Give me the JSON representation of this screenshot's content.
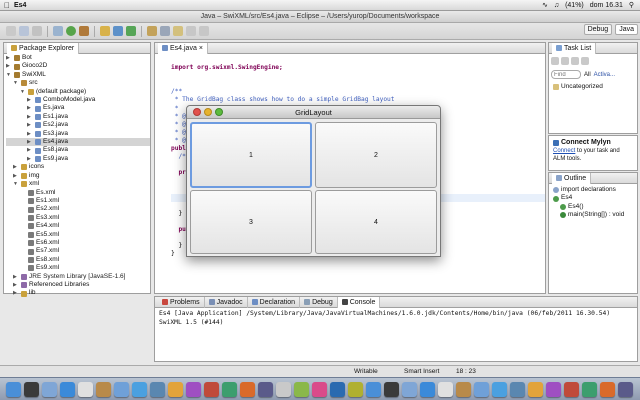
{
  "menubar": {
    "apple": "",
    "app_name": "Es4",
    "battery": "(41%)",
    "clock": "dom 16.31"
  },
  "window": {
    "title": "Java – SwiXML/src/Es4.java – Eclipse – /Users/yurop/Documents/workspace"
  },
  "perspectives": {
    "debug": "Debug",
    "java": "Java"
  },
  "package_explorer": {
    "tab": "Package Explorer",
    "rows": [
      {
        "label": "Bot",
        "indent": 0,
        "tri": "▶",
        "color": "#a47b2f"
      },
      {
        "label": "Gioco2D",
        "indent": 0,
        "tri": "▶",
        "color": "#a47b2f"
      },
      {
        "label": "SwiXML",
        "indent": 0,
        "tri": "▼",
        "color": "#a47b2f"
      },
      {
        "label": "src",
        "indent": 1,
        "tri": "▼",
        "color": "#b88b3a"
      },
      {
        "label": "(default package)",
        "indent": 2,
        "tri": "▼",
        "color": "#c9a13c"
      },
      {
        "label": "ComboModel.java",
        "indent": 3,
        "tri": "▶",
        "color": "#6d8ec4"
      },
      {
        "label": "Es.java",
        "indent": 3,
        "tri": "▶",
        "color": "#6d8ec4"
      },
      {
        "label": "Es1.java",
        "indent": 3,
        "tri": "▶",
        "color": "#6d8ec4"
      },
      {
        "label": "Es2.java",
        "indent": 3,
        "tri": "▶",
        "color": "#6d8ec4"
      },
      {
        "label": "Es3.java",
        "indent": 3,
        "tri": "▶",
        "color": "#6d8ec4"
      },
      {
        "label": "Es4.java",
        "indent": 3,
        "tri": "▶",
        "color": "#6d8ec4",
        "selected": true
      },
      {
        "label": "Es8.java",
        "indent": 3,
        "tri": "▶",
        "color": "#6d8ec4"
      },
      {
        "label": "Es9.java",
        "indent": 3,
        "tri": "▶",
        "color": "#6d8ec4"
      },
      {
        "label": "icons",
        "indent": 1,
        "tri": "▶",
        "color": "#c9a13c"
      },
      {
        "label": "img",
        "indent": 1,
        "tri": "▶",
        "color": "#c9a13c"
      },
      {
        "label": "xml",
        "indent": 1,
        "tri": "▼",
        "color": "#c9a13c"
      },
      {
        "label": "Es.xml",
        "indent": 2,
        "tri": "",
        "color": "#7a7a7a"
      },
      {
        "label": "Es1.xml",
        "indent": 2,
        "tri": "",
        "color": "#7a7a7a"
      },
      {
        "label": "Es2.xml",
        "indent": 2,
        "tri": "",
        "color": "#7a7a7a"
      },
      {
        "label": "Es3.xml",
        "indent": 2,
        "tri": "",
        "color": "#7a7a7a"
      },
      {
        "label": "Es4.xml",
        "indent": 2,
        "tri": "",
        "color": "#7a7a7a"
      },
      {
        "label": "Es5.xml",
        "indent": 2,
        "tri": "",
        "color": "#7a7a7a"
      },
      {
        "label": "Es6.xml",
        "indent": 2,
        "tri": "",
        "color": "#7a7a7a"
      },
      {
        "label": "Es7.xml",
        "indent": 2,
        "tri": "",
        "color": "#7a7a7a"
      },
      {
        "label": "Es8.xml",
        "indent": 2,
        "tri": "",
        "color": "#7a7a7a"
      },
      {
        "label": "Es9.xml",
        "indent": 2,
        "tri": "",
        "color": "#7a7a7a"
      },
      {
        "label": "JRE System Library [JavaSE-1.6]",
        "indent": 1,
        "tri": "▶",
        "color": "#8e6aa8"
      },
      {
        "label": "Referenced Libraries",
        "indent": 1,
        "tri": "▶",
        "color": "#8e6aa8"
      },
      {
        "label": "lib",
        "indent": 1,
        "tri": "▶",
        "color": "#c9a13c"
      }
    ]
  },
  "editor": {
    "tab": "Es4.java",
    "code_lines": [
      "",
      "import org.swixml.SwingEngine;",
      "",
      "",
      "/**",
      " * The GridBag class shows how to do a simple GridBag layout",
      " *",
      " * @",
      " * @",
      " * @",
      " * @",
      "publ",
      "  /**",
      "",
      "  pri",
      "",
      "",
      "",
      "",
      "  }",
      "",
      "  publ",
      "    n",
      "  }",
      "}"
    ]
  },
  "dialog": {
    "title": "GridLayout",
    "buttons": [
      "1",
      "2",
      "3",
      "4"
    ]
  },
  "task_list": {
    "tab": "Task List",
    "find_placeholder": "Find",
    "all": "All",
    "activate": "Activa...",
    "uncategorized": "Uncategorized"
  },
  "mylyn": {
    "title": "Connect Mylyn",
    "link": "Connect",
    "text": " to your task and ALM tools."
  },
  "outline": {
    "tab": "Outline",
    "items": [
      {
        "label": "import declarations",
        "indent": 0
      },
      {
        "label": "Es4",
        "indent": 0
      },
      {
        "label": "Es4()",
        "indent": 1
      },
      {
        "label": "main(String[]) : void",
        "indent": 1
      }
    ]
  },
  "bottom": {
    "tabs": [
      "Problems",
      "Javadoc",
      "Declaration",
      "Debug",
      "Console"
    ],
    "active_tab": "Console",
    "console_header": "Es4 [Java Application] /System/Library/Java/JavaVirtualMachines/1.6.0.jdk/Contents/Home/bin/java (06/feb/2011 16.30.54)",
    "console_output": "SwiXML 1.5 (#144)"
  },
  "status": {
    "writable": "Writable",
    "insert": "Smart Insert",
    "position": "18 : 23"
  },
  "dock_icons": [
    "finder-icon",
    "dashboard-icon",
    "mail-icon",
    "safari-icon",
    "ical-icon",
    "addressbook-icon",
    "preview-icon",
    "itunes-icon",
    "iphoto-icon",
    "garageband-icon",
    "app-icon",
    "app-icon",
    "app-icon",
    "app-icon",
    "app-icon",
    "app-icon",
    "app-icon",
    "app-icon",
    "app-icon",
    "app-icon",
    "app-icon",
    "app-icon",
    "app-icon",
    "app-icon",
    "app-icon",
    "app-icon",
    "app-icon",
    "app-icon",
    "app-icon",
    "app-icon",
    "app-icon",
    "app-icon",
    "app-icon",
    "app-icon",
    "trash-icon"
  ],
  "colors": {
    "selection": "#5a87d4",
    "accent": "#3a64b4"
  }
}
